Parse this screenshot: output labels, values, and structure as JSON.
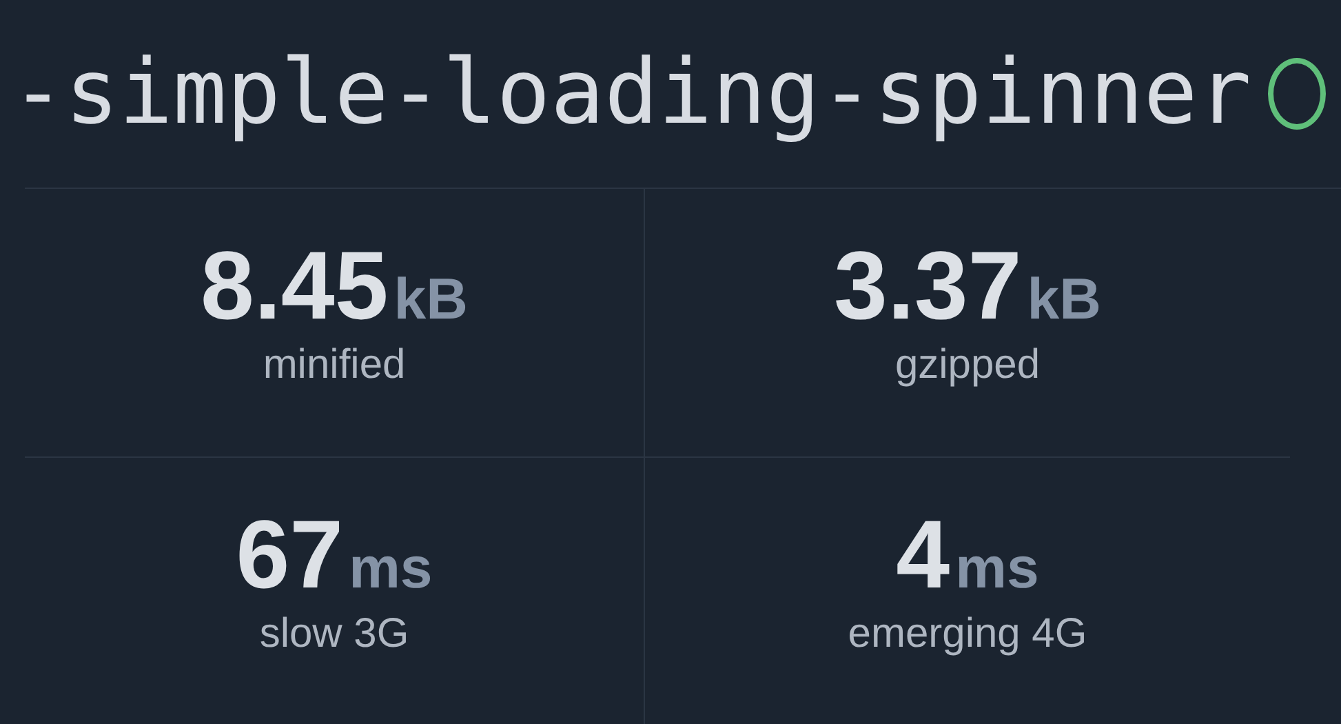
{
  "package": {
    "name": "-simple-loading-spinner"
  },
  "stats": [
    {
      "value": "8.45",
      "unit": "kB",
      "label": "minified"
    },
    {
      "value": "3.37",
      "unit": "kB",
      "label": "gzipped"
    },
    {
      "value": "67",
      "unit": "ms",
      "label": "slow 3G"
    },
    {
      "value": "4",
      "unit": "ms",
      "label": "emerging 4G"
    }
  ]
}
